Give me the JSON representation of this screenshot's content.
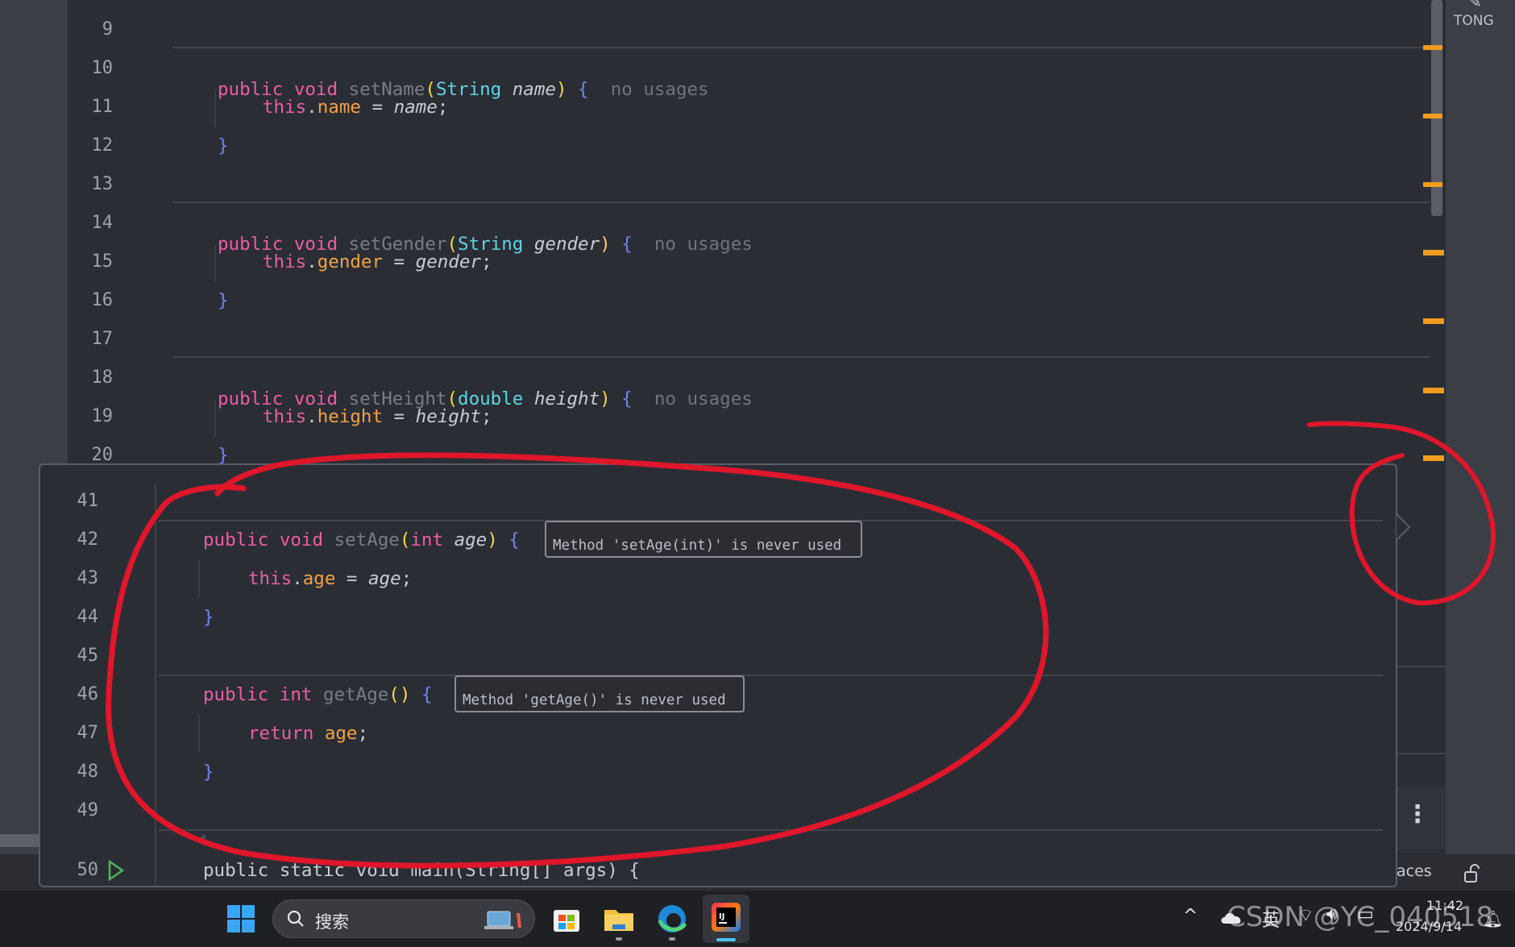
{
  "editor": {
    "lines": [
      {
        "num": "9"
      },
      {
        "num": "10",
        "kw1": "public",
        "kw2": "void",
        "name": "setName",
        "ptype": "String",
        "pname": "name",
        "hint": "no usages"
      },
      {
        "num": "11",
        "this": "this",
        "field": "name",
        "eq": " = ",
        "val": "name",
        "semi": ";"
      },
      {
        "num": "12",
        "brace": "}"
      },
      {
        "num": "13"
      },
      {
        "num": "14",
        "kw1": "public",
        "kw2": "void",
        "name": "setGender",
        "ptype": "String",
        "pname": "gender",
        "hint": "no usages"
      },
      {
        "num": "15",
        "this": "this",
        "field": "gender",
        "eq": " = ",
        "val": "gender",
        "semi": ";"
      },
      {
        "num": "16",
        "brace": "}"
      },
      {
        "num": "17"
      },
      {
        "num": "18",
        "kw1": "public",
        "kw2": "void",
        "name": "setHeight",
        "ptype": "double",
        "pname": "height",
        "hint": "no usages"
      },
      {
        "num": "19",
        "this": "this",
        "field": "height",
        "eq": " = ",
        "val": "height",
        "semi": ";"
      },
      {
        "num": "20",
        "brace": "}"
      }
    ],
    "top_right_label": "TONG"
  },
  "popup": {
    "lines": [
      {
        "num": "41"
      },
      {
        "num": "42",
        "kw1": "public",
        "kw2": "void",
        "name": "setAge",
        "ptype": "int",
        "pname": "age",
        "tooltip": "Method 'setAge(int)' is never used"
      },
      {
        "num": "43",
        "this": "this",
        "field": "age",
        "eq": " = ",
        "val": "age",
        "semi": ";"
      },
      {
        "num": "44",
        "brace": "}"
      },
      {
        "num": "45"
      },
      {
        "num": "46",
        "kw1": "public",
        "kw2": "int",
        "name": "getAge",
        "tooltip": "Method 'getAge()' is never used"
      },
      {
        "num": "47",
        "kw": "return",
        "field": "age",
        "semi": ";"
      },
      {
        "num": "48",
        "brace": "}"
      },
      {
        "num": "49"
      },
      {
        "num": "50",
        "partial": "public static void main(String[] args) {"
      }
    ]
  },
  "side_panel": {
    "status_text": "aces",
    "menu_icon": "kebab-menu-icon",
    "lock_icon": "lock-icon"
  },
  "taskbar": {
    "search_placeholder": "搜索",
    "ime": "英",
    "time": "11:42",
    "date": "2024/9/14",
    "watermark": "CSDN @YC_040518"
  },
  "colors": {
    "editor_bg": "#2b2d35",
    "keyword": "#e95fa2",
    "type": "#5fd4e4",
    "field": "#f0a246",
    "warning_marker": "#f29c1d",
    "annotation_red": "#e0162b"
  }
}
